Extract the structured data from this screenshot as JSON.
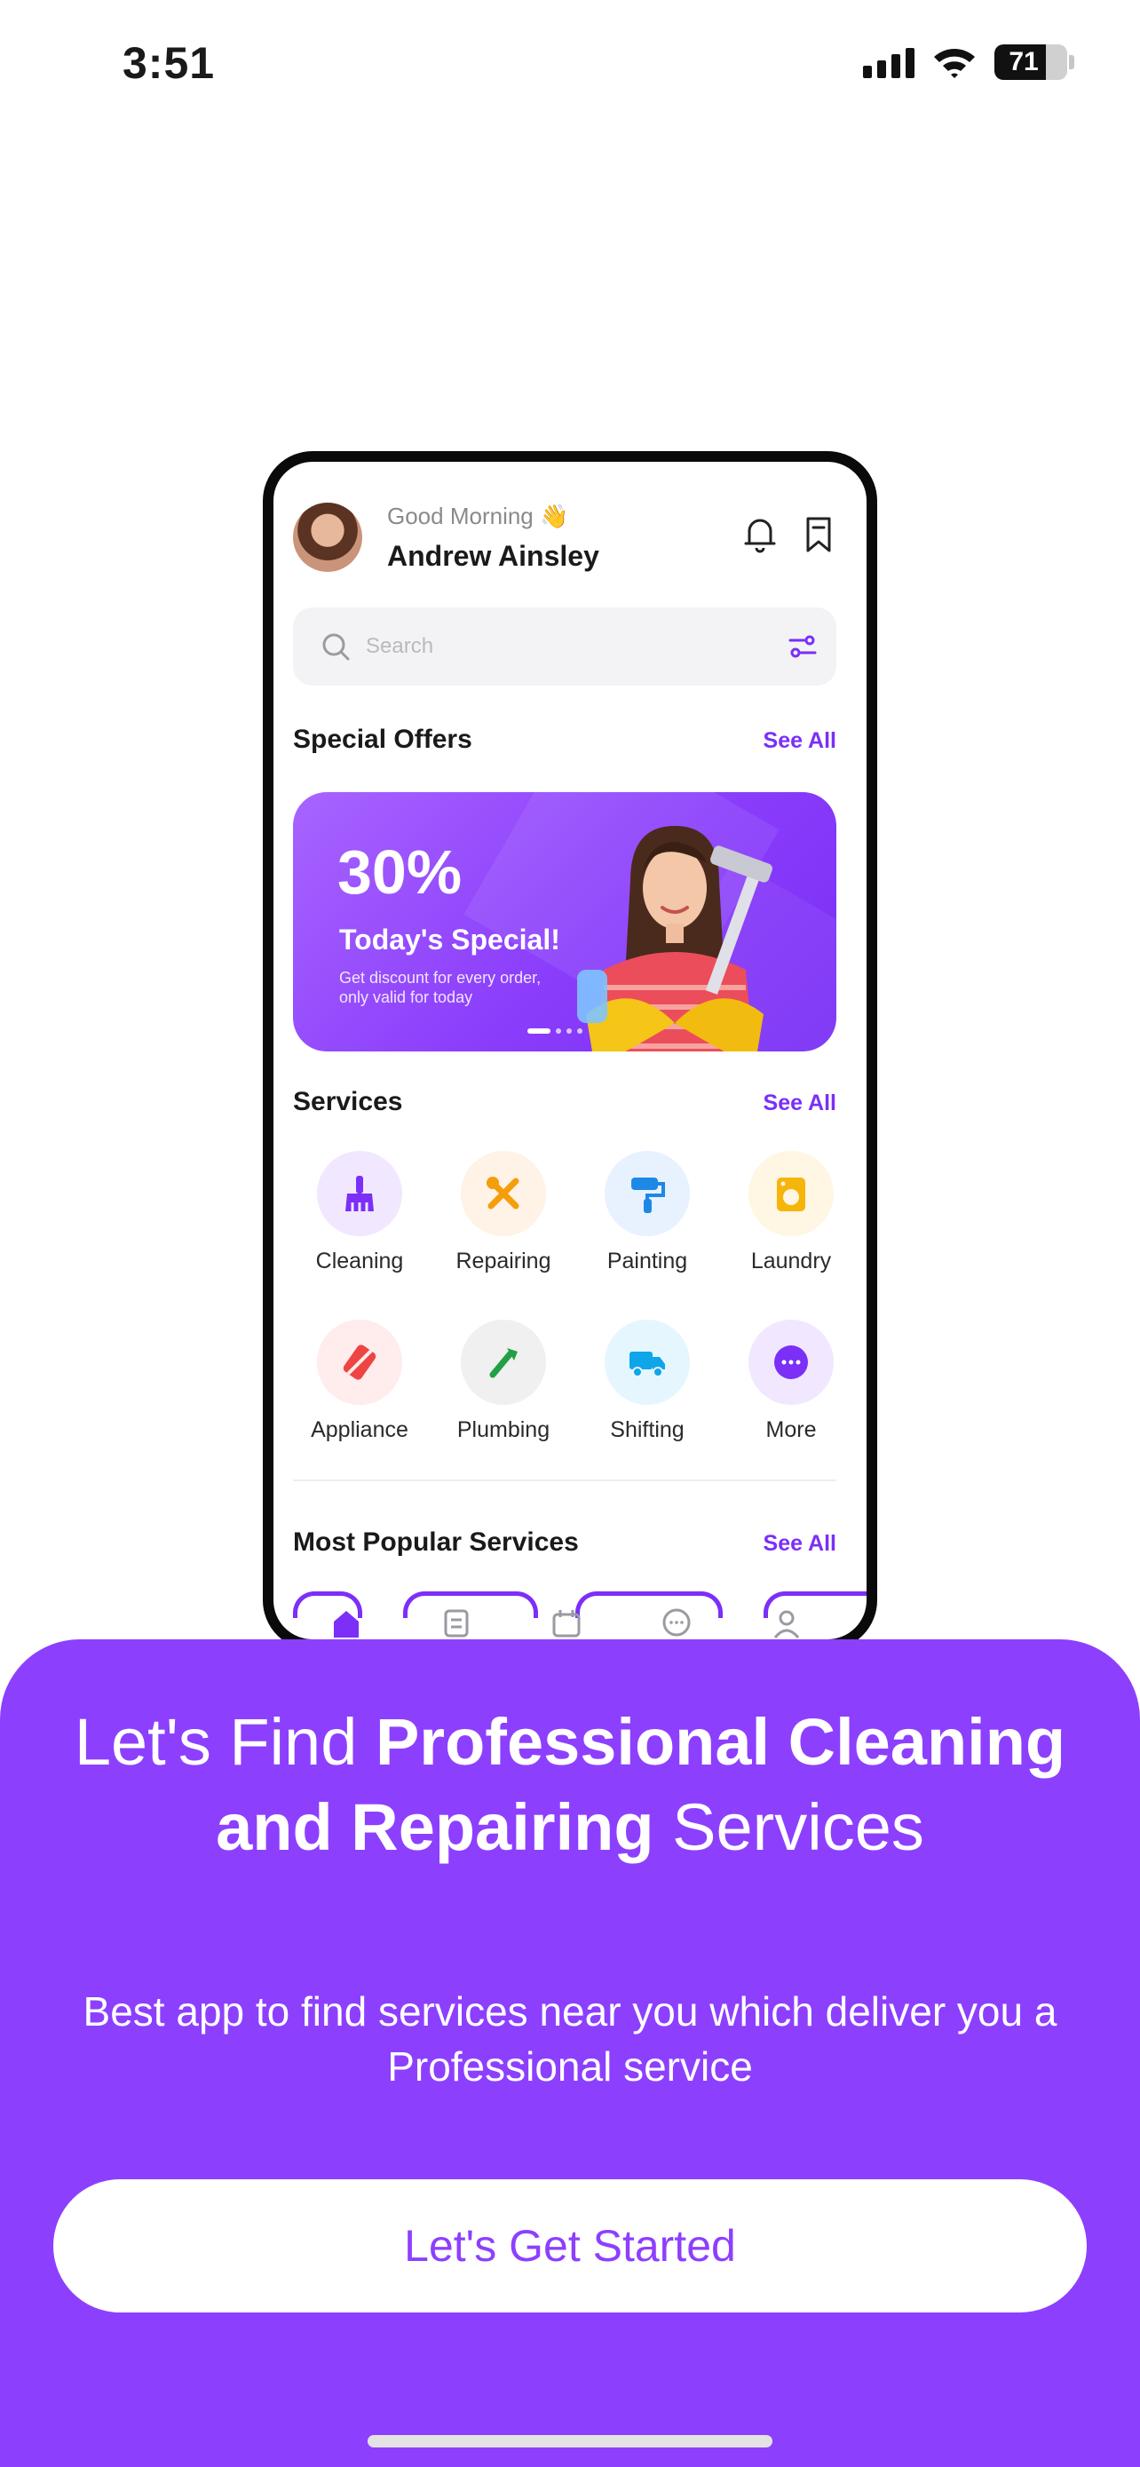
{
  "status_bar": {
    "time": "3:51",
    "battery": "71"
  },
  "mockup": {
    "greeting": "Good Morning 👋",
    "user_name": "Andrew Ainsley",
    "search_placeholder": "Search",
    "special_offers": {
      "title": "Special Offers",
      "see_all": "See All"
    },
    "offer": {
      "percent": "30%",
      "title": "Today's Special!",
      "description": "Get discount for every order, only valid for today"
    },
    "services": {
      "title": "Services",
      "see_all": "See All",
      "items": [
        {
          "label": "Cleaning",
          "icon": "broom-icon",
          "bg": "#f1e8ff",
          "color": "#7b2ff7"
        },
        {
          "label": "Repairing",
          "icon": "tools-icon",
          "bg": "#fff2e6",
          "color": "#f59e0b"
        },
        {
          "label": "Painting",
          "icon": "paint-roller-icon",
          "bg": "#e8f2ff",
          "color": "#1e88e5"
        },
        {
          "label": "Laundry",
          "icon": "washing-machine-icon",
          "bg": "#fff6e3",
          "color": "#f5b50b"
        },
        {
          "label": "Appliance",
          "icon": "appliance-icon",
          "bg": "#ffecec",
          "color": "#ef4444"
        },
        {
          "label": "Plumbing",
          "icon": "wrench-icon",
          "bg": "#f0f0f0",
          "color": "#22a046"
        },
        {
          "label": "Shifting",
          "icon": "truck-icon",
          "bg": "#e6f6ff",
          "color": "#0ea5e9"
        },
        {
          "label": "More",
          "icon": "more-icon",
          "bg": "#f1e8ff",
          "color": "#7b2ff7"
        }
      ]
    },
    "popular": {
      "title": "Most Popular Services",
      "see_all": "See All"
    }
  },
  "onboarding": {
    "headline_1": "Let's Find ",
    "headline_bold": "Professional Cleaning and Repairing",
    "headline_2": " Services",
    "subtext": "Best app to find services near you which deliver you a Professional service",
    "cta_label": "Let's Get Started"
  },
  "colors": {
    "accent": "#8d3ffe",
    "brand_purple": "#7b2ff7"
  }
}
